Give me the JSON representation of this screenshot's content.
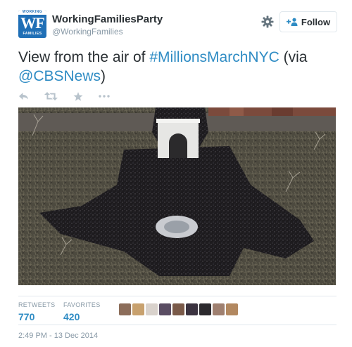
{
  "account": {
    "avatar_top": "WORKING",
    "avatar_letters": "WF",
    "avatar_bottom": "FAMILIES",
    "full_name": "WorkingFamiliesParty",
    "handle": "@WorkingFamilies"
  },
  "header": {
    "settings_icon": "gear-icon",
    "follow_label": "Follow",
    "follow_icon": "person-plus-icon"
  },
  "tweet": {
    "text_before": "View from the air of ",
    "hashtag": "#MillionsMarchNYC",
    "text_middle": " (via ",
    "mention": "@CBSNews",
    "text_after": ")"
  },
  "actions": [
    {
      "icon": "reply-icon"
    },
    {
      "icon": "retweet-icon"
    },
    {
      "icon": "favorite-star-icon"
    },
    {
      "icon": "more-dots-icon"
    }
  ],
  "stats": {
    "retweets_label": "RETWEETS",
    "retweets_value": "770",
    "favorites_label": "FAVORITES",
    "favorites_value": "420"
  },
  "timestamp": "2:49 PM - 13 Dec 2014",
  "colors": {
    "link": "#2f8cc4",
    "brand": "#1f6fb6",
    "muted": "#8899a6",
    "text": "#292f33"
  }
}
